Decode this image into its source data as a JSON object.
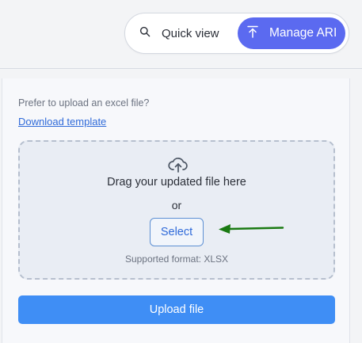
{
  "header": {
    "quick_view_label": "Quick view",
    "manage_ari_label": "Manage ARI",
    "quick_view_icon": "search-icon",
    "manage_ari_icon": "upload-arrow-icon",
    "accent_color": "#5b6af0"
  },
  "upload_panel": {
    "prompt_text": "Prefer to upload an excel file?",
    "download_link_label": "Download template",
    "dropzone": {
      "icon": "cloud-upload-icon",
      "drag_text": "Drag your updated file here",
      "or_text": "or",
      "select_label": "Select",
      "supported_format": "Supported format: XLSX"
    },
    "upload_button_label": "Upload file",
    "upload_button_color": "#3f8ef5",
    "annotation_arrow_color": "#1a7a12"
  }
}
